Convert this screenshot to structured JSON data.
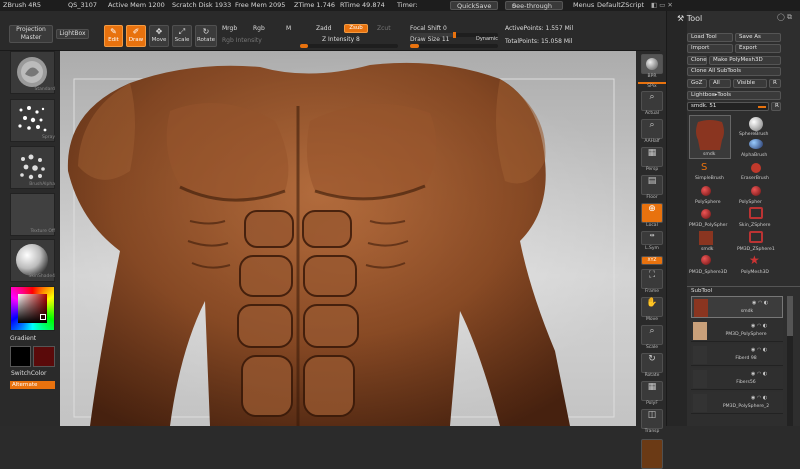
{
  "topbar": {
    "app": "ZBrush 4R5",
    "qs": "QS_3107",
    "active_mem": "Active Mem 1200",
    "scratch": "Scratch Disk 1933",
    "free_mem": "Free Mem 2095",
    "ztime": "ZTime 1.746",
    "rtime": "RTime 49.874",
    "timer": "Timer:",
    "quicksave": "QuickSave",
    "seethrough": "See-through",
    "seethrough_value": "0",
    "menus": "Menus",
    "script": "DefaultZScript"
  },
  "toolbar": {
    "projection_master": "Projection Master",
    "lightbox": "LightBox",
    "edit": "Edit",
    "draw": "Draw",
    "move": "Move",
    "scale": "Scale",
    "rotate": "Rotate",
    "mrgb": "Mrgb",
    "rgb": "Rgb",
    "m": "M",
    "rgb_intensity": "Rgb Intensity",
    "zadd": "Zadd",
    "zsub": "Zsub",
    "zcut": "Zcut",
    "z_intensity": "Z Intensity 8",
    "focal_shift": "Focal Shift",
    "focal_shift_value": "0",
    "draw_size": "Draw Size",
    "draw_size_value": "11",
    "dynamic": "Dynamic",
    "active_points": "ActivePoints: 1.557 Mil",
    "total_points": "TotalPoints: 15.058 Mil",
    "z_intensity_fill": 0.08,
    "draw_size_fill": 0.1
  },
  "left": {
    "standard": "Standard",
    "spray": "Spray",
    "brushalpha": "BrushAlpha",
    "texture_off": "Texture Off",
    "skinshade": "SkinShade4",
    "gradient": "Gradient",
    "switchcolor": "SwitchColor",
    "alternate": "Alternate"
  },
  "right_tools": [
    "BPR",
    "SPix",
    "Actual",
    "AAHalf",
    "Persp",
    "Floor",
    "Local",
    "L.Sym",
    "XYZ",
    "Frame",
    "Move",
    "Scale",
    "Rotate",
    "PolyF",
    "Transp"
  ],
  "tool_panel": {
    "title": "Tool",
    "load_tool": "Load Tool",
    "save_as": "Save As",
    "import": "Import",
    "export": "Export",
    "clone": "Clone",
    "make_polymesh": "Make PolyMesh3D",
    "clone_all": "Clone All SubTools",
    "goz": "GoZ",
    "all": "All",
    "visible": "Visible",
    "r": "R",
    "lightbox_tools": "Lightbox▸Tools",
    "smdk": "smdk. 51",
    "tools": [
      "smdk",
      "SphereBrush",
      "AlphaBrush",
      "SimpleBrush",
      "EraserBrush",
      "PolySphere",
      "PolySpher",
      "PM3D_PolySpher",
      "Skin_ZSphere",
      "smdk",
      "PM3D_ZSphere1",
      "PM3D_Sphere3D",
      "PolyMesh3D"
    ],
    "subtool": "SubTool",
    "subtools": [
      "smdk",
      "PM3D_PolySphere",
      "Fiberd 98",
      "Fibers56",
      "PM3D_PolySphere_2"
    ]
  }
}
